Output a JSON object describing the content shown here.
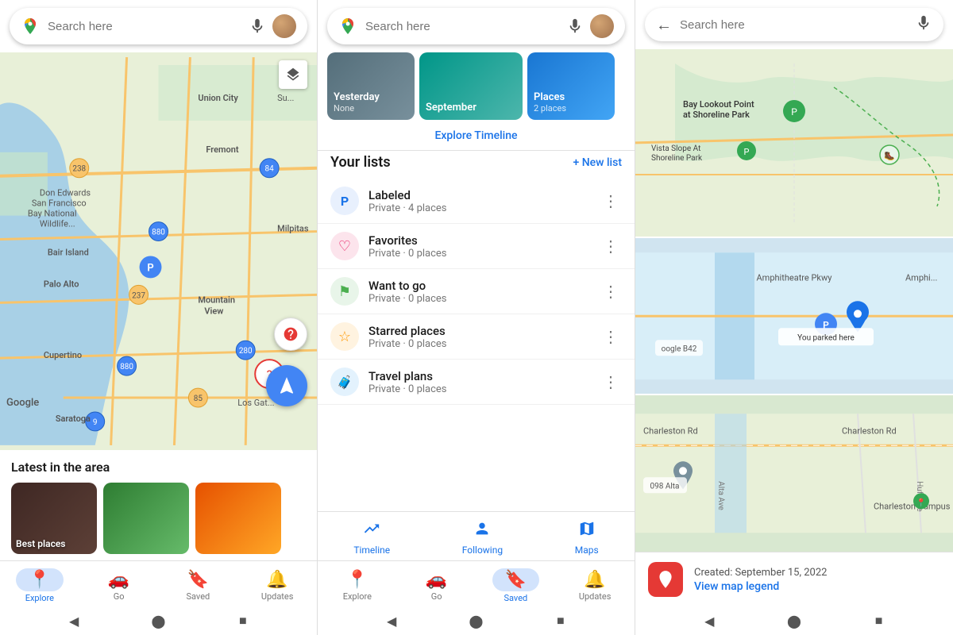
{
  "left_panel": {
    "search": {
      "placeholder": "Search here",
      "mic_label": "mic",
      "avatar_label": "user avatar"
    },
    "map": {
      "layers_label": "layers",
      "nav_label": "navigation",
      "question_label": "question",
      "google_label": "Google",
      "parking_label": "You parked here"
    },
    "latest": {
      "title": "Latest in the area",
      "places": [
        {
          "label": "Best places",
          "color": "pc-dark"
        },
        {
          "label": "",
          "color": "pc-green"
        },
        {
          "label": "",
          "color": "pc-amber"
        }
      ]
    },
    "bottom_nav": [
      {
        "label": "Explore",
        "icon": "📍",
        "active": true
      },
      {
        "label": "Go",
        "icon": "🚗",
        "active": false
      },
      {
        "label": "Saved",
        "icon": "🔖",
        "active": false
      },
      {
        "label": "Updates",
        "icon": "🔔",
        "active": false
      }
    ],
    "system_nav": [
      "◀",
      "⬤",
      "■"
    ]
  },
  "middle_panel": {
    "search": {
      "placeholder": "Search here",
      "mic_label": "mic",
      "avatar_label": "user avatar"
    },
    "timeline_cards": [
      {
        "label": "Yesterday",
        "sub": "None",
        "color": "overlay-dark"
      },
      {
        "label": "September",
        "sub": "",
        "color": "overlay-teal"
      },
      {
        "label": "Places",
        "sub": "2 places",
        "color": "overlay-blue"
      }
    ],
    "explore_timeline": "Explore Timeline",
    "lists_title": "Your lists",
    "new_list_label": "+ New list",
    "lists": [
      {
        "name": "Labeled",
        "sub": "Private · 4 places",
        "icon": "🅿",
        "icon_color": "#1a73e8",
        "icon_bg": "#e8f0fd"
      },
      {
        "name": "Favorites",
        "sub": "Private · 0 places",
        "icon": "♡",
        "icon_color": "#e91e63",
        "icon_bg": "#fce4ec"
      },
      {
        "name": "Want to go",
        "sub": "Private · 0 places",
        "icon": "⚑",
        "icon_color": "#4caf50",
        "icon_bg": "#e8f5e9"
      },
      {
        "name": "Starred places",
        "sub": "Private · 0 places",
        "icon": "☆",
        "icon_color": "#ff9800",
        "icon_bg": "#fff3e0"
      },
      {
        "name": "Travel plans",
        "sub": "Private · 0 places",
        "icon": "🧳",
        "icon_color": "#2196f3",
        "icon_bg": "#e3f2fd"
      }
    ],
    "tabs": [
      {
        "label": "Timeline",
        "icon": "📈"
      },
      {
        "label": "Following",
        "icon": "👤"
      },
      {
        "label": "Maps",
        "icon": "🗺"
      }
    ],
    "bottom_nav": [
      {
        "label": "Explore",
        "icon": "📍",
        "active": false
      },
      {
        "label": "Go",
        "icon": "🚗",
        "active": false
      },
      {
        "label": "Saved",
        "icon": "🔖",
        "active": true
      },
      {
        "label": "Updates",
        "icon": "🔔",
        "active": false
      }
    ],
    "system_nav": [
      "◀",
      "⬤",
      "■"
    ]
  },
  "right_panel": {
    "search": {
      "placeholder": "Search here",
      "back_label": "back",
      "mic_label": "mic"
    },
    "map_sections": [
      {
        "label": "Bay Lookout Point at Shoreline Park",
        "sublabel": "Vista Slope At Shoreline Park"
      },
      {
        "label": "You parked here",
        "sublabel": "Amphitheatre Pkwy"
      },
      {
        "label": "Charleston Campus",
        "sublabel": "Charleston Rd"
      }
    ],
    "info_card": {
      "created_label": "Created: September 15, 2022",
      "legend_label": "View map legend"
    },
    "system_nav": [
      "◀",
      "⬤",
      "■"
    ]
  }
}
